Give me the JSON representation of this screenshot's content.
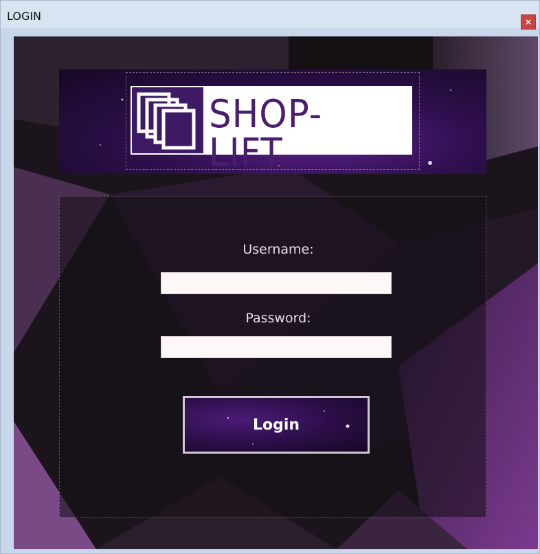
{
  "window": {
    "title": "LOGIN",
    "close_glyph": "×"
  },
  "logo": {
    "text": "SHOP-LIFT",
    "icon": "stacked-squares-icon"
  },
  "form": {
    "username_label": "Username:",
    "username_value": "",
    "password_label": "Password:",
    "password_value": "",
    "login_label": "Login"
  },
  "colors": {
    "accent": "#4a1d6e",
    "background_dark": "#1c141d",
    "titlebar": "#d8e4f2",
    "close_button": "#c8463f"
  }
}
